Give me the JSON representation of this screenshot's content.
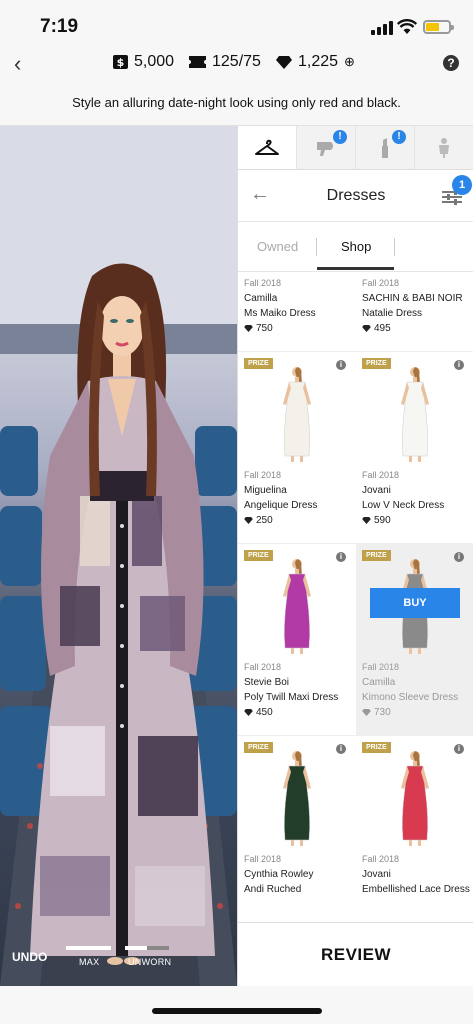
{
  "status": {
    "time": "7:19"
  },
  "header": {
    "cash": "5,000",
    "tickets": "125/75",
    "diamonds": "1,225",
    "add_symbol": "⊕"
  },
  "challenge": "Style an alluring date-night look using only red and black.",
  "stage": {
    "undo_label": "UNDO",
    "max_label": "MAX",
    "unworn_label": "UNWORN"
  },
  "panel": {
    "category_tabs": [
      {
        "icon": "hanger-icon",
        "active": true
      },
      {
        "icon": "hairdryer-icon",
        "badge": "!"
      },
      {
        "icon": "lipstick-icon",
        "badge": "!"
      },
      {
        "icon": "mannequin-icon"
      }
    ],
    "title": "Dresses",
    "filter_badge": "1",
    "tabs": {
      "owned": "Owned",
      "shop": "Shop"
    },
    "items": [
      {
        "season": "Fall 2018",
        "brand": "Camilla",
        "name": "Ms Maiko Dress",
        "price": "750",
        "prize": false,
        "color": "#e8d7c0"
      },
      {
        "season": "Fall 2018",
        "brand": "SACHIN & BABI NOIR",
        "name": "Natalie Dress",
        "price": "495",
        "prize": false,
        "color": "#222222"
      },
      {
        "season": "Fall 2018",
        "brand": "Miguelina",
        "name": "Angelique Dress",
        "price": "250",
        "prize": true,
        "prize_label": "PRIZE",
        "color": "#f4f1ea"
      },
      {
        "season": "Fall 2018",
        "brand": "Jovani",
        "name": "Low V Neck Dress",
        "price": "590",
        "prize": true,
        "prize_label": "PRIZE",
        "color": "#f6f6f2"
      },
      {
        "season": "Fall 2018",
        "brand": "Stevie Boi",
        "name": "Poly Twill Maxi Dress",
        "price": "450",
        "prize": true,
        "prize_label": "PRIZE",
        "color": "#b23aa6"
      },
      {
        "season": "Fall 2018",
        "brand": "Camilla",
        "name": "Kimono Sleeve Dress",
        "price": "730",
        "prize": true,
        "prize_label": "PRIZE",
        "buy_label": "BUY",
        "color": "#8a8a8a"
      },
      {
        "season": "Fall 2018",
        "brand": "Cynthia Rowley",
        "name": "Andi Ruched",
        "price": "",
        "prize": true,
        "prize_label": "PRIZE",
        "color": "#233d2b"
      },
      {
        "season": "Fall 2018",
        "brand": "Jovani",
        "name": "Embellished Lace Dress",
        "price": "",
        "prize": true,
        "prize_label": "PRIZE",
        "color": "#d83a4f"
      }
    ],
    "review_label": "REVIEW"
  },
  "colors": {
    "accent": "#2a85e8",
    "prize": "#bfa14b"
  }
}
